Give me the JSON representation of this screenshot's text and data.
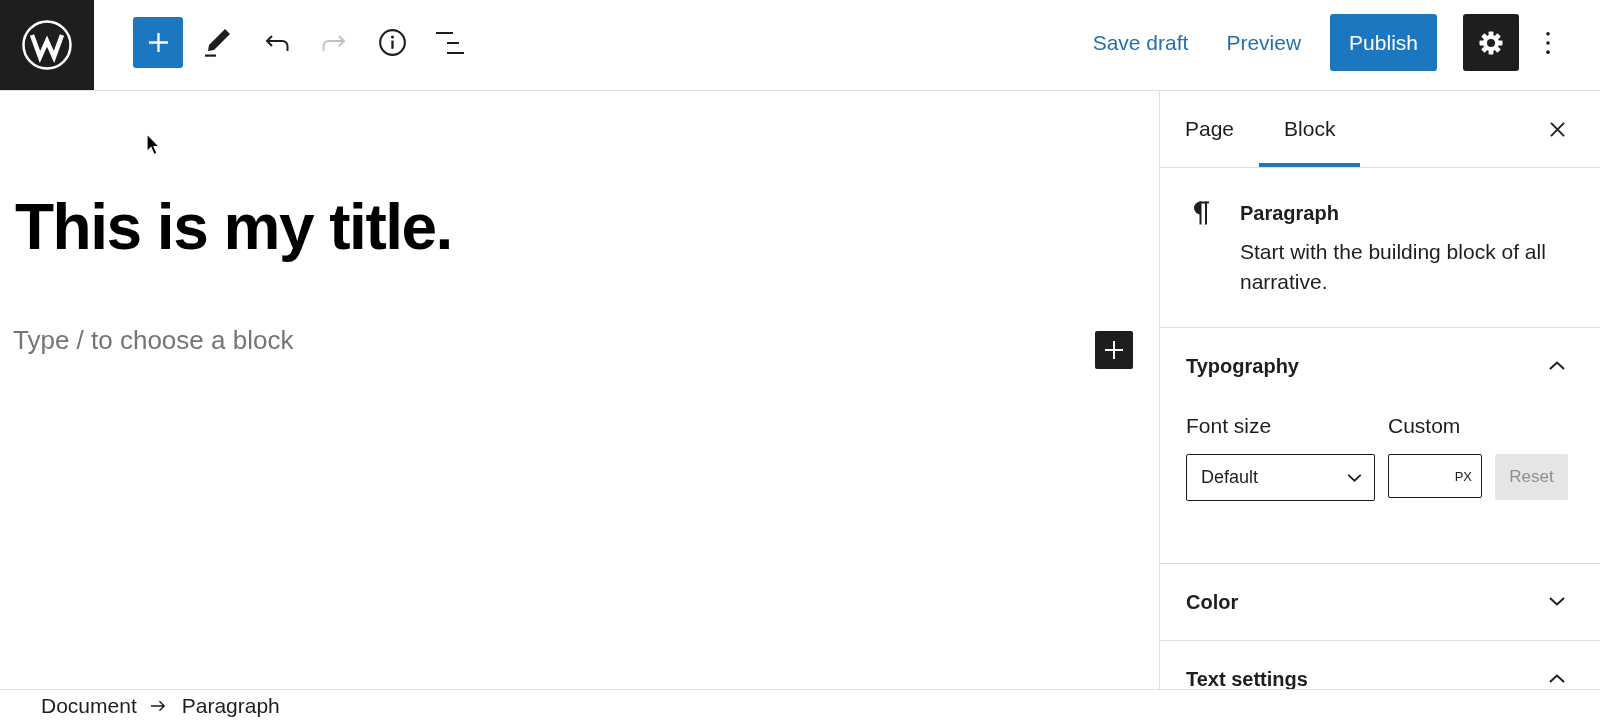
{
  "toolbar": {
    "tools": [
      {
        "kind": "add",
        "disabled": false
      },
      {
        "kind": "edit",
        "disabled": false
      },
      {
        "kind": "undo",
        "disabled": false
      },
      {
        "kind": "redo",
        "disabled": true
      },
      {
        "kind": "info",
        "disabled": false
      },
      {
        "kind": "list",
        "disabled": false
      }
    ],
    "actions": [
      {
        "kind": "link",
        "label": "Save draft"
      },
      {
        "kind": "link",
        "label": "Preview"
      },
      {
        "kind": "primary",
        "label": "Publish"
      }
    ],
    "settings": {
      "pressed": true
    }
  },
  "editor": {
    "title": "This is my title.",
    "paragraph": {
      "placeholder": "Type / to choose a block"
    }
  },
  "sidebar": {
    "tabs": [
      {
        "label": "Page",
        "selected": false
      },
      {
        "label": "Block",
        "selected": true
      }
    ],
    "block_card": {
      "title": "Paragraph",
      "description": "Start with the building block of all narrative."
    },
    "panels": [
      {
        "title": "Typography",
        "expanded": true,
        "font_size": {
          "label": "Font size",
          "value": "Default",
          "custom_label": "Custom",
          "unit": "PX",
          "reset": {
            "label": "Reset",
            "disabled": true
          }
        }
      },
      {
        "title": "Color",
        "expanded": false
      },
      {
        "title": "Text settings",
        "expanded": true
      }
    ]
  },
  "breadcrumbs": [
    "Document",
    "Paragraph"
  ]
}
